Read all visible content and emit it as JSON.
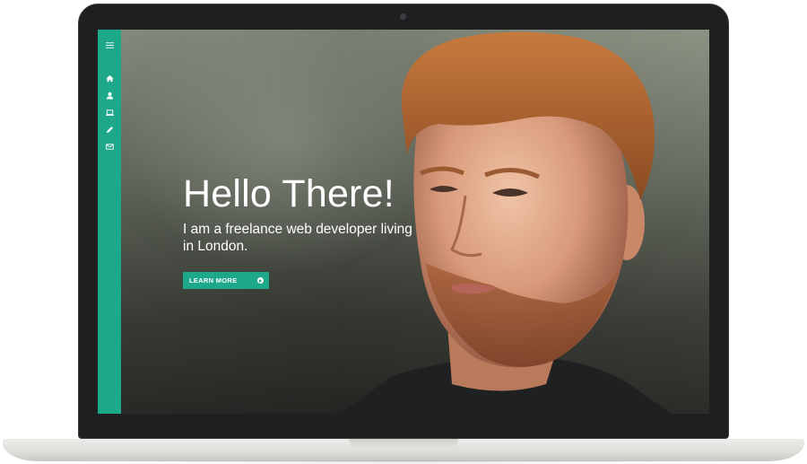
{
  "sidebar": {
    "items": [
      {
        "icon": "home-icon"
      },
      {
        "icon": "user-icon"
      },
      {
        "icon": "laptop-icon"
      },
      {
        "icon": "pencil-icon"
      },
      {
        "icon": "envelope-icon"
      }
    ]
  },
  "hero": {
    "title": "Hello There!",
    "subtitle": "I am a freelance web developer living in London.",
    "cta_label": "LEARN MORE"
  },
  "colors": {
    "accent": "#1ea88a",
    "laptop_frame": "#1e1f21",
    "laptop_base": "#e4e5e0"
  }
}
